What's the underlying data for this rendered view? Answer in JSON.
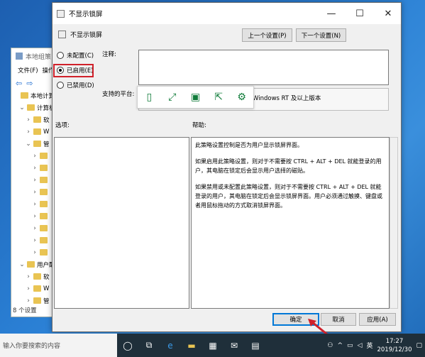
{
  "bg_window": {
    "title": "本地组策",
    "menu": [
      "文件(F)",
      "操作"
    ],
    "tree": [
      {
        "label": "本地计算",
        "indent": 0,
        "chev": ""
      },
      {
        "label": "计算机",
        "indent": 1,
        "chev": "v"
      },
      {
        "label": "软",
        "indent": 2,
        "chev": ">"
      },
      {
        "label": "W",
        "indent": 2,
        "chev": ">"
      },
      {
        "label": "管",
        "indent": 2,
        "chev": "v"
      },
      {
        "label": "",
        "indent": 3,
        "chev": ">"
      },
      {
        "label": "",
        "indent": 3,
        "chev": ">"
      },
      {
        "label": "",
        "indent": 3,
        "chev": ">"
      },
      {
        "label": "",
        "indent": 3,
        "chev": ">"
      },
      {
        "label": "",
        "indent": 3,
        "chev": ">"
      },
      {
        "label": "",
        "indent": 3,
        "chev": ">"
      },
      {
        "label": "",
        "indent": 3,
        "chev": ">"
      },
      {
        "label": "",
        "indent": 3,
        "chev": ">"
      },
      {
        "label": "",
        "indent": 3,
        "chev": ">"
      },
      {
        "label": "用户配",
        "indent": 1,
        "chev": "v"
      },
      {
        "label": "软",
        "indent": 2,
        "chev": ">"
      },
      {
        "label": "W",
        "indent": 2,
        "chev": ">"
      },
      {
        "label": "管",
        "indent": 2,
        "chev": ">"
      }
    ],
    "status": "8 个设置"
  },
  "dialog": {
    "title": "不显示锁屏",
    "setting_name": "不显示锁屏",
    "prev_button": "上一个设置(P)",
    "next_button": "下一个设置(N)",
    "radio_not_configured": "未配置(C)",
    "radio_enabled": "已启用(E)",
    "radio_disabled": "已禁用(D)",
    "comment_label": "注释:",
    "platform_label": "支持的平台:",
    "platform_value": "Windows RT 及以上版本",
    "options_label": "选项:",
    "help_label": "帮助:",
    "help_paragraphs": [
      "此策略设置控制是否为用户显示锁屏界面。",
      "如果启用此策略设置，则对于不需要按 CTRL + ALT + DEL 就能登录的用户，其电脑在锁定后会显示用户选择的磁贴。",
      "如果禁用或未配置此策略设置，则对于不需要按 CTRL + ALT + DEL 就能登录的用户，其电脑在锁定后会显示锁屏界面。用户必须通过触摸、键盘或者用鼠标拖动的方式取消锁屏界面。"
    ],
    "ok_button": "确定",
    "cancel_button": "取消",
    "apply_button": "应用(A)"
  },
  "taskbar": {
    "search_placeholder": "输入你要搜索的内容",
    "lang": "英",
    "time": "17:27",
    "date": "2019/12/30"
  },
  "colors": {
    "highlight": "#d0202a",
    "accent": "#0078d7"
  }
}
